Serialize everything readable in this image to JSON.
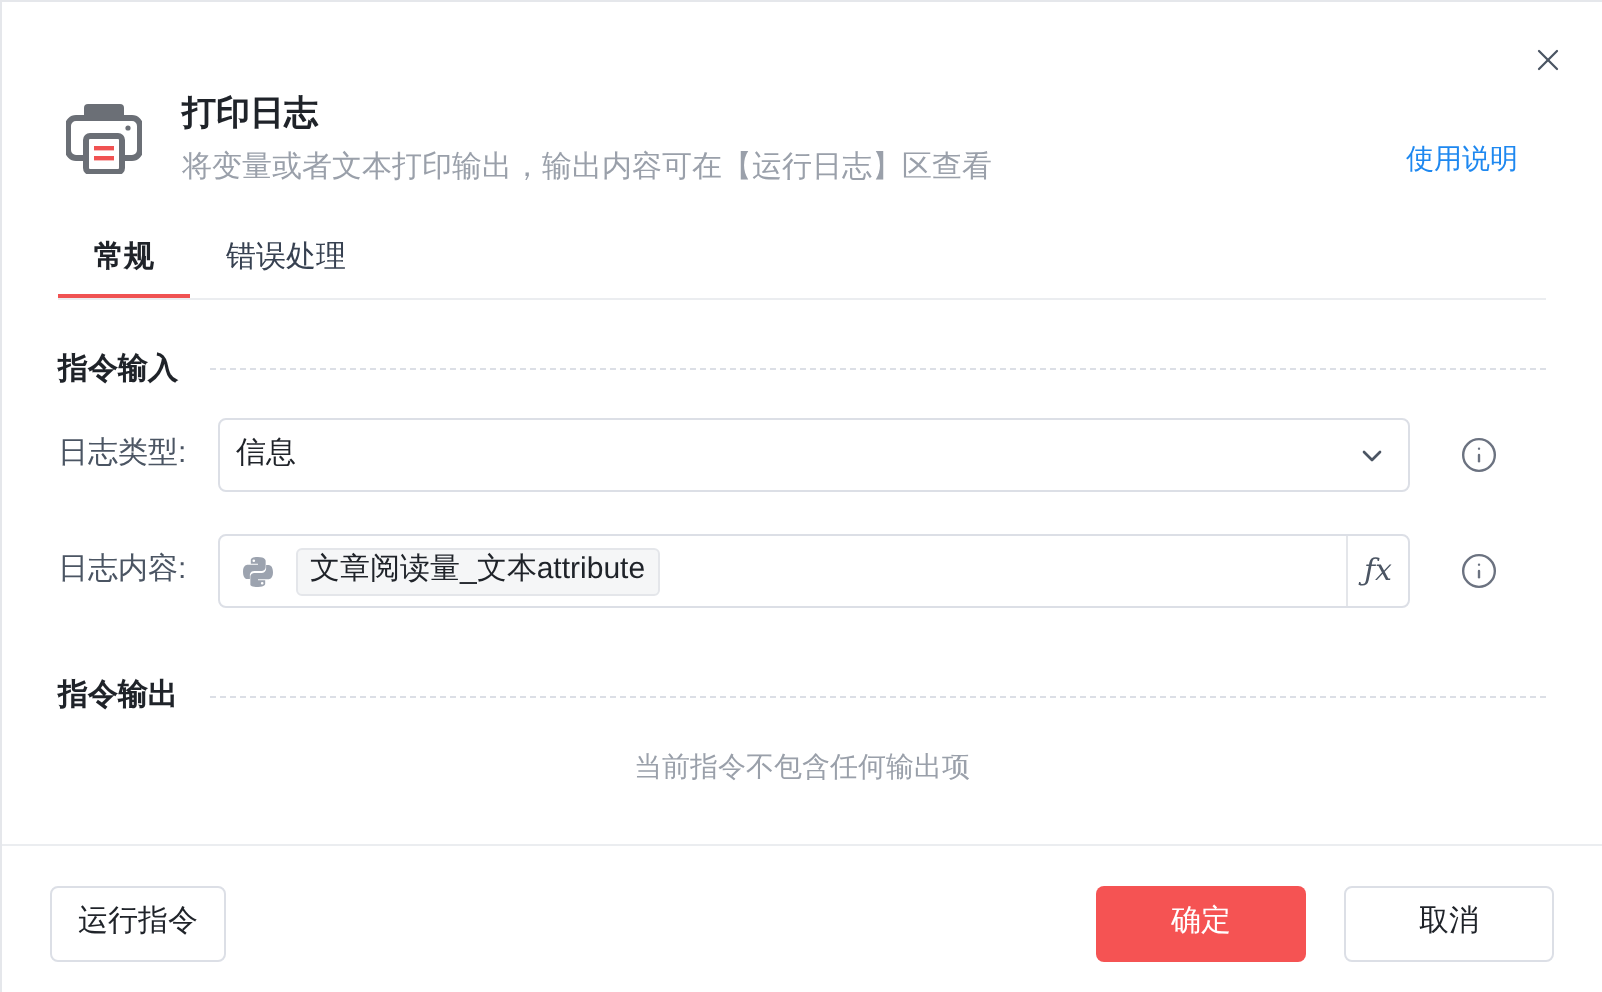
{
  "dialog": {
    "title": "打印日志",
    "subtitle": "将变量或者文本打印输出，输出内容可在【运行日志】区查看",
    "help_link": "使用说明"
  },
  "tabs": [
    {
      "label": "常规",
      "selected": true
    },
    {
      "label": "错误处理",
      "selected": false
    }
  ],
  "input_section": {
    "title": "指令输入",
    "fields": [
      {
        "kind": "select",
        "label": "日志类型:",
        "value": "信息"
      },
      {
        "kind": "expression",
        "label": "日志内容:",
        "token": "文章阅读量_文本attribute",
        "fx": "ƒx"
      }
    ]
  },
  "output_section": {
    "title": "指令输出",
    "empty_text": "当前指令不包含任何输出项"
  },
  "footer": {
    "run_button": "运行指令",
    "confirm_button": "确定",
    "cancel_button": "取消"
  }
}
